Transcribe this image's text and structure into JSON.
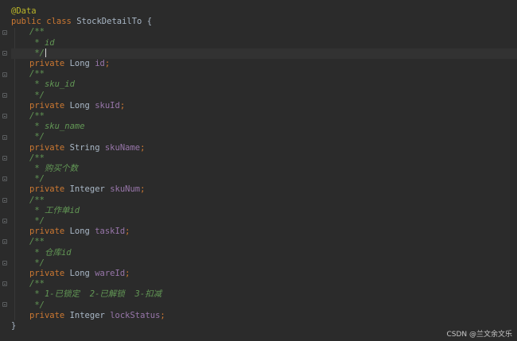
{
  "code": {
    "annotation": "@Data",
    "class_decl": {
      "kw_public": "public",
      "kw_class": "class",
      "name": "StockDetailTo",
      "brace_open": "{"
    },
    "fields": [
      {
        "comment_open": "/**",
        "comment_text": " * id",
        "comment_close": " */",
        "kw": "private",
        "type": "Long",
        "name": "id",
        "semi": ";"
      },
      {
        "comment_open": "/**",
        "comment_text": " * sku_id",
        "comment_close": " */",
        "kw": "private",
        "type": "Long",
        "name": "skuId",
        "semi": ";"
      },
      {
        "comment_open": "/**",
        "comment_text": " * sku_name",
        "comment_close": " */",
        "kw": "private",
        "type": "String",
        "name": "skuName",
        "semi": ";"
      },
      {
        "comment_open": "/**",
        "comment_text": " * 购买个数",
        "comment_close": " */",
        "kw": "private",
        "type": "Integer",
        "name": "skuNum",
        "semi": ";"
      },
      {
        "comment_open": "/**",
        "comment_text": " * 工作单id",
        "comment_close": " */",
        "kw": "private",
        "type": "Long",
        "name": "taskId",
        "semi": ";"
      },
      {
        "comment_open": "/**",
        "comment_text": " * 仓库id",
        "comment_close": " */",
        "kw": "private",
        "type": "Long",
        "name": "wareId",
        "semi": ";"
      },
      {
        "comment_open": "/**",
        "comment_text": " * 1-已锁定  2-已解锁  3-扣减",
        "comment_close": " */",
        "kw": "private",
        "type": "Integer",
        "name": "lockStatus",
        "semi": ";"
      }
    ],
    "brace_close": "}"
  },
  "watermark": "CSDN @兰文余文乐",
  "colors": {
    "background": "#2b2b2b",
    "keyword": "#cc7832",
    "annotation": "#bbb529",
    "field": "#9876aa",
    "doc_comment": "#629755",
    "plain_text": "#a9b7c6"
  }
}
